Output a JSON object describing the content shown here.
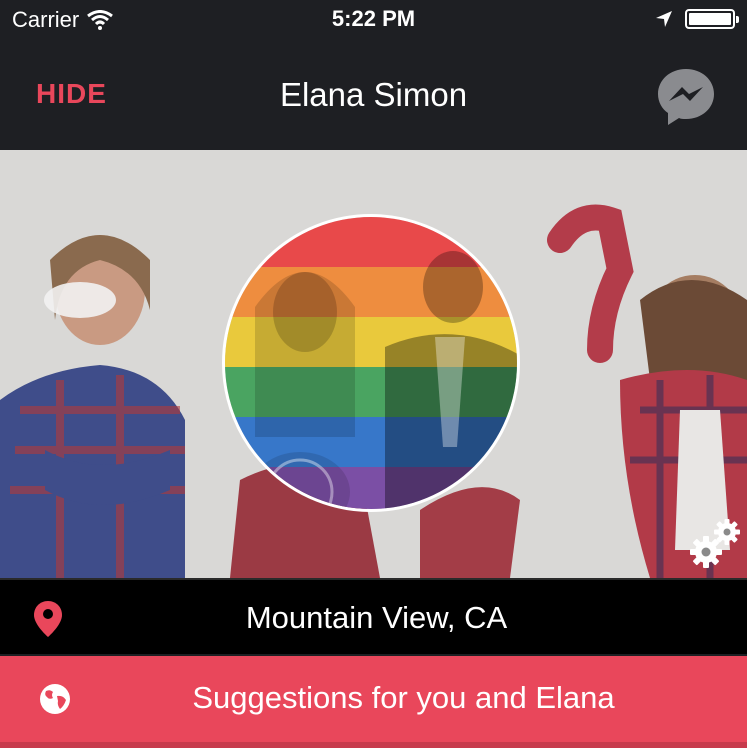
{
  "status_bar": {
    "carrier": "Carrier",
    "time": "5:22 PM",
    "battery_level": 1.0,
    "icons": [
      "wifi-icon",
      "location-arrow-icon",
      "battery-icon"
    ]
  },
  "nav": {
    "hide_label": "HIDE",
    "title": "Elana Simon",
    "messenger_icon": "messenger-icon"
  },
  "profile": {
    "photo_overlay": "rainbow-flag-filter",
    "settings_icon": "gear-icon"
  },
  "location": {
    "icon": "map-pin-icon",
    "text": "Mountain View, CA"
  },
  "suggestions": {
    "icon": "globe-icon",
    "label": "Suggestions for you and Elana"
  },
  "colors": {
    "accent": "#e9475b",
    "bar": "#1e1f23",
    "location_bg": "#000000",
    "hero_bg": "#d9d8d6"
  }
}
